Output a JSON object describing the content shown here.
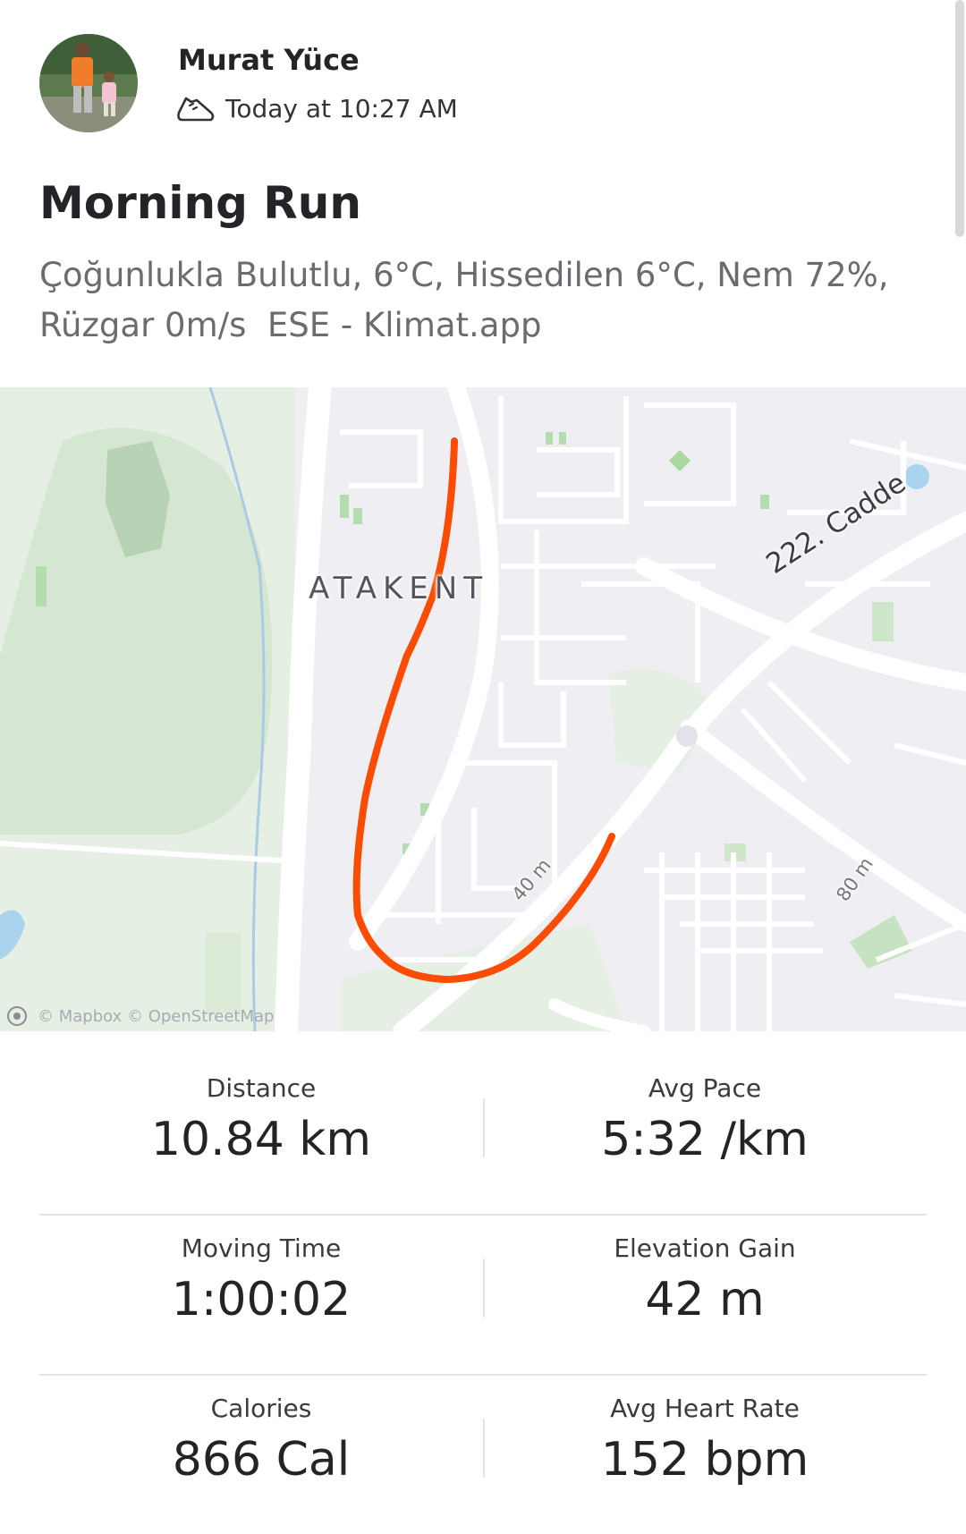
{
  "header": {
    "athlete_name": "Murat Yüce",
    "timestamp": "Today at 10:27 AM",
    "activity_icon": "running-shoe-icon"
  },
  "activity": {
    "title": "Morning Run",
    "description_lines": [
      "Çoğunlukla Bulutlu, 6°C, Hissedilen 6°C, Nem 72%,",
      "Rüzgar 0m/s  ESE - Klimat.app"
    ]
  },
  "map": {
    "area_label": "ATAKENT",
    "road_label": "222. Cadde",
    "height_labels": [
      "40 m",
      "80 m"
    ],
    "attribution": "© Mapbox © OpenStreetMap",
    "route_color": "#fc4c02"
  },
  "stats": [
    [
      {
        "label": "Distance",
        "value": "10.84 km"
      },
      {
        "label": "Avg Pace",
        "value": "5:32 /km"
      }
    ],
    [
      {
        "label": "Moving Time",
        "value": "1:00:02"
      },
      {
        "label": "Elevation Gain",
        "value": "42 m"
      }
    ],
    [
      {
        "label": "Calories",
        "value": "866 Cal"
      },
      {
        "label": "Avg Heart Rate",
        "value": "152 bpm"
      }
    ]
  ]
}
